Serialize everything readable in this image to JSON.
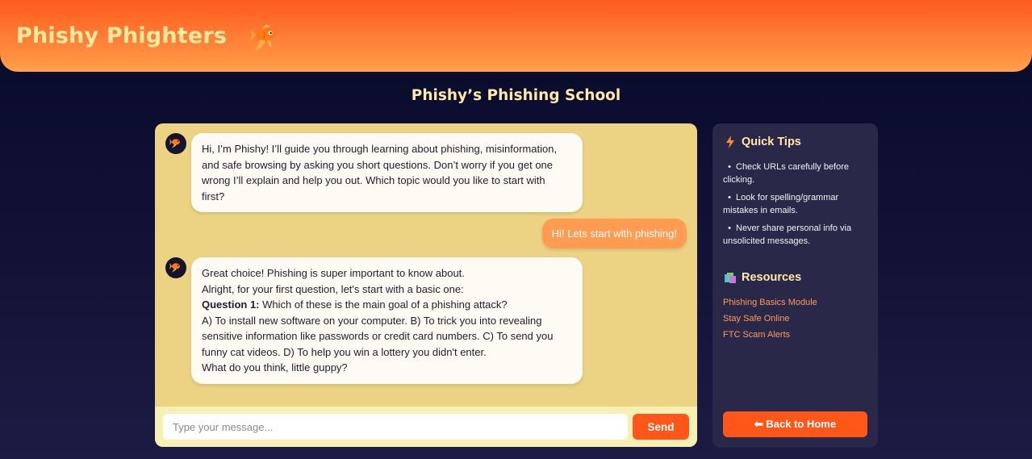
{
  "header": {
    "brand": "Phishy Phighters",
    "logo_icon": "goldfish-icon"
  },
  "page_title": "Phishy’s Phishing School",
  "chat": {
    "messages": [
      {
        "role": "bot",
        "avatar_icon": "goldfish-icon",
        "lines": [
          "Hi, I’m Phishy! I’ll guide you through learning about phishing, misinformation,",
          "and safe browsing by asking you short questions. Don’t worry if you get one",
          "wrong I’ll explain and help you out. Which topic would you like to start with",
          "first?"
        ]
      },
      {
        "role": "user",
        "text": "Hi! Lets start with phishing!"
      },
      {
        "role": "bot",
        "avatar_icon": "goldfish-icon",
        "line1": "Great choice! Phishing is super important to know about.",
        "line2": "Alright, for your first question, let's start with a basic one:",
        "question_label": "Question 1:",
        "question_text": " Which of these is the main goal of a phishing attack?",
        "options_lines": [
          "A) To install new software on your computer. B) To trick you into revealing",
          "sensitive information like passwords or credit card numbers. C) To send you",
          "funny cat videos. D) To help you win a lottery you didn't enter."
        ],
        "closing": "What do you think, little guppy?"
      }
    ],
    "input_placeholder": "Type your message...",
    "input_value": "",
    "send_label": "Send"
  },
  "sidebar": {
    "tips_heading": "Quick Tips",
    "tips_icon": "lightning-icon",
    "tips": [
      "Check URLs carefully before clicking.",
      "Look for spelling/grammar mistakes in emails.",
      "Never share personal info via unsolicited messages."
    ],
    "resources_heading": "Resources",
    "resources_icon": "books-icon",
    "resources": [
      "Phishing Basics Module",
      "Stay Safe Online",
      "FTC Scam Alerts"
    ],
    "back_label": "⬅ Back to Home"
  },
  "colors": {
    "header_top": "#ff5a1f",
    "header_bottom": "#ffa04a",
    "brand_text": "#ffeaa0",
    "chat_bg": "#ecd383",
    "user_bubble": "#ff9c52",
    "accent": "#ff5719",
    "link": "#ff9a56",
    "sidebar_bg": "#2a2848"
  }
}
